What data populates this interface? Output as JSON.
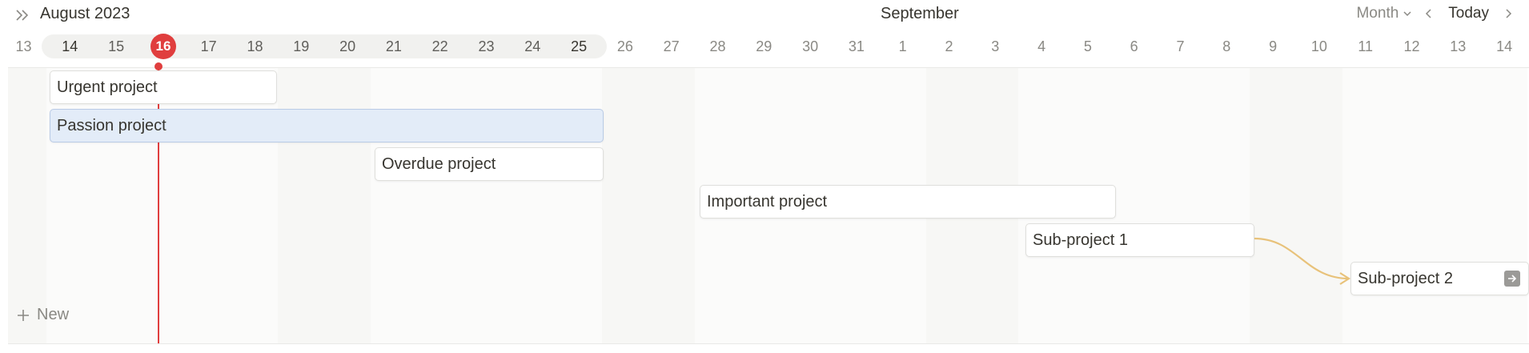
{
  "header": {
    "current_month": "August 2023",
    "next_month": "September",
    "view_label": "Month",
    "today_label": "Today"
  },
  "timeline": {
    "days": [
      "13",
      "14",
      "15",
      "16",
      "17",
      "18",
      "19",
      "20",
      "21",
      "22",
      "23",
      "24",
      "25",
      "26",
      "27",
      "28",
      "29",
      "30",
      "31",
      "1",
      "2",
      "3",
      "4",
      "5",
      "6",
      "7",
      "8",
      "9",
      "10",
      "11",
      "12",
      "13",
      "14"
    ],
    "today": "16",
    "weekend_indices": [
      0,
      6,
      7,
      13,
      14,
      20,
      21,
      27,
      28
    ]
  },
  "projects": [
    {
      "name": "Urgent project"
    },
    {
      "name": "Passion project"
    },
    {
      "name": "Overdue project"
    },
    {
      "name": "Important project"
    },
    {
      "name": "Sub-project 1"
    },
    {
      "name": "Sub-project 2"
    }
  ],
  "dependency_color": "#e8c27a",
  "today_color": "#e03e3e",
  "new_label": "New",
  "icons": {
    "expand": "double-chevron-right-icon",
    "view_dropdown": "chevron-down-icon",
    "prev": "chevron-left-icon",
    "next": "chevron-right-icon",
    "add": "plus-icon",
    "jump": "arrow-right-icon"
  }
}
